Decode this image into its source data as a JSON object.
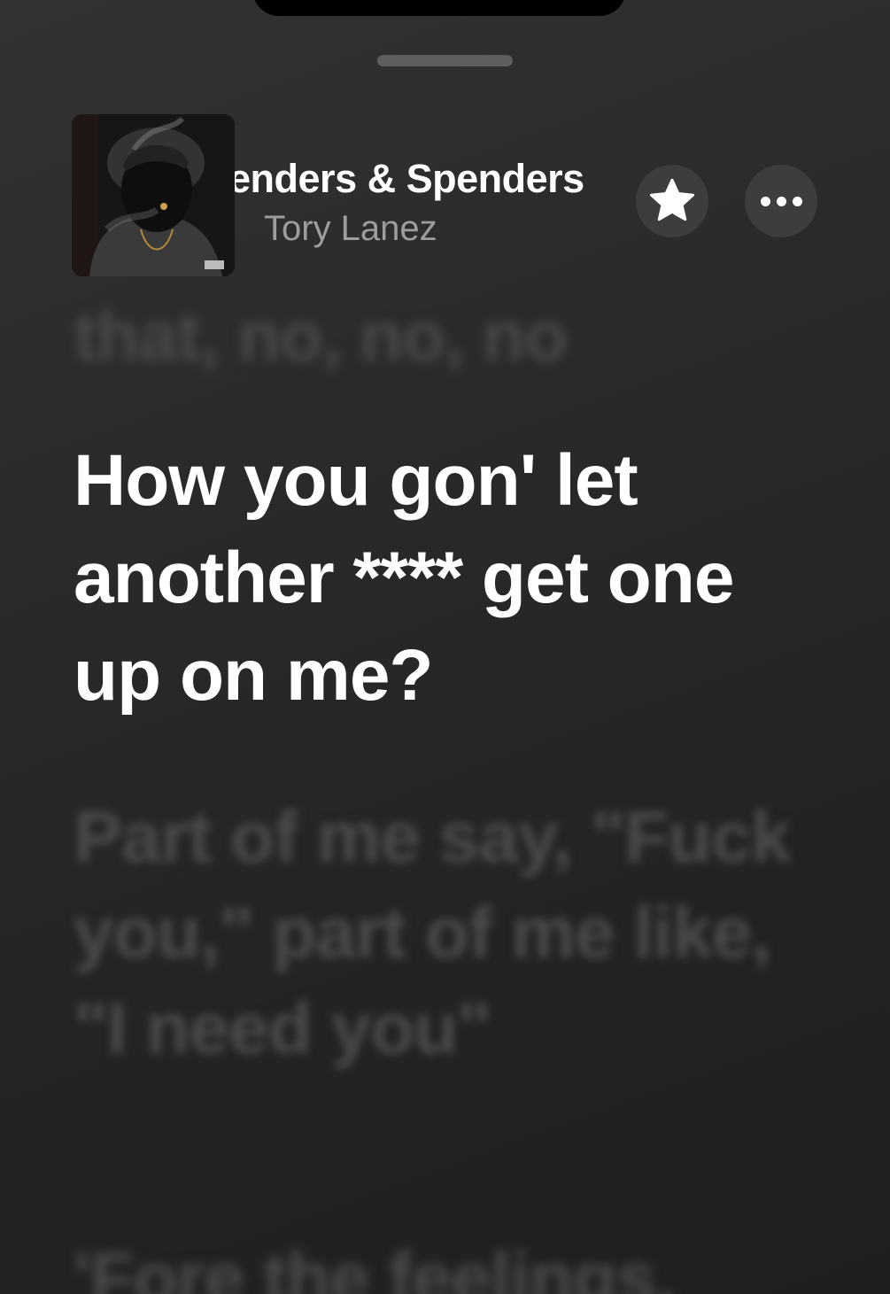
{
  "now_playing": {
    "title": "Bartenders & Spenders",
    "artist": "Tory Lanez",
    "artwork_icon": "album-artwork"
  },
  "buttons": {
    "favorite_icon": "star-icon",
    "more_icon": "ellipsis-icon"
  },
  "lyrics": {
    "previous": "that, no, no, no",
    "current": "How you gon' let another **** get one up on me?",
    "next": "Part of me say, \"Fuck you,\" part of me like, \"I need you\"",
    "after": "'Fore the feelings,"
  },
  "colors": {
    "background": "#2a2a2a",
    "active_lyric": "#ffffff",
    "inactive_lyric": "#4b4b4b",
    "artist": "#9d9d9d"
  }
}
